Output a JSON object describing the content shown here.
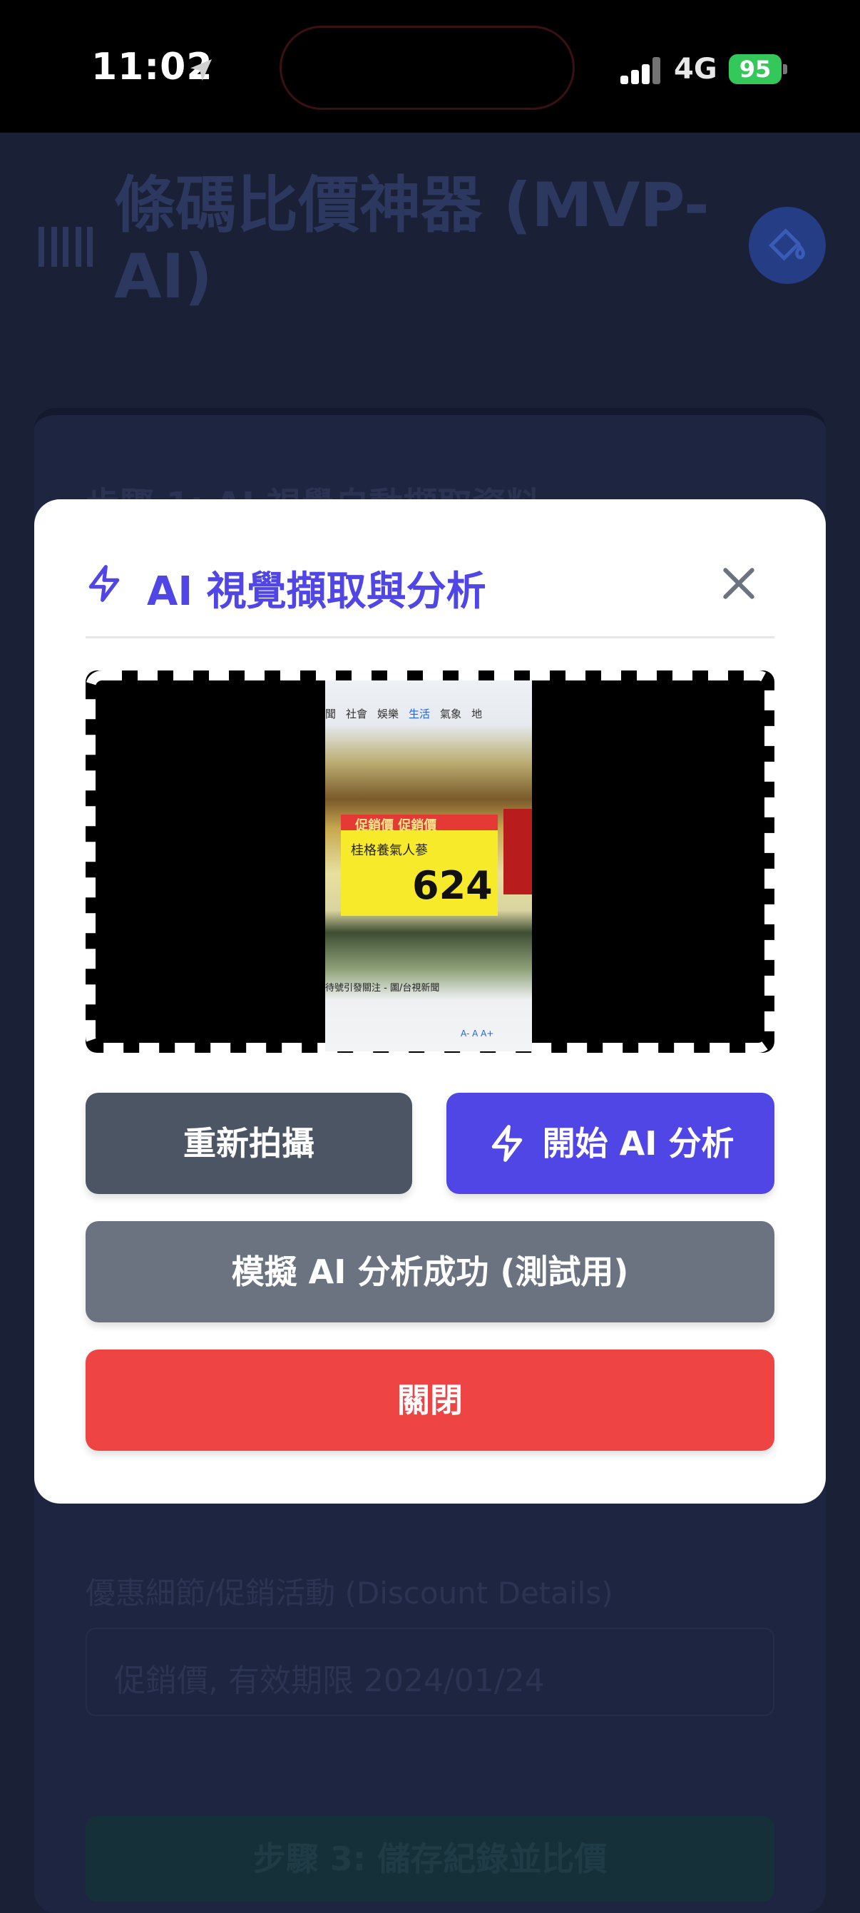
{
  "status_bar": {
    "time": "11:02",
    "network": "4G",
    "battery": "95"
  },
  "background_app": {
    "title": "條碼比價神器 (MVP-AI)",
    "step1_heading": "步驟 1: AI 視覺自動擷取資料",
    "discount_label": "優惠細節/促銷活動 (Discount Details)",
    "discount_value": "促銷價, 有效期限 2024/01/24",
    "step3_button": "步驟 3: 儲存紀錄並比價"
  },
  "modal": {
    "title": "AI 視覺擷取與分析",
    "photo": {
      "tabs": [
        "聞",
        "社會",
        "娛樂",
        "生活",
        "氣象",
        "地"
      ],
      "active_tab": "生活",
      "tag_header": "促銷價 促銷價",
      "product_name": "桂格養氣人蔘",
      "price": "624",
      "caption": "待號引發關注 - 圖/台視新聞",
      "font_controls": "A-  A  A+"
    },
    "buttons": {
      "retake": "重新拍攝",
      "analyze": "開始 AI 分析",
      "mock": "模擬 AI 分析成功 (測試用)",
      "close": "關閉"
    }
  },
  "colors": {
    "accent": "#4f46e5",
    "danger": "#ef4444",
    "secondary": "#4b5563",
    "muted": "#6b7280",
    "battery": "#34c759"
  }
}
